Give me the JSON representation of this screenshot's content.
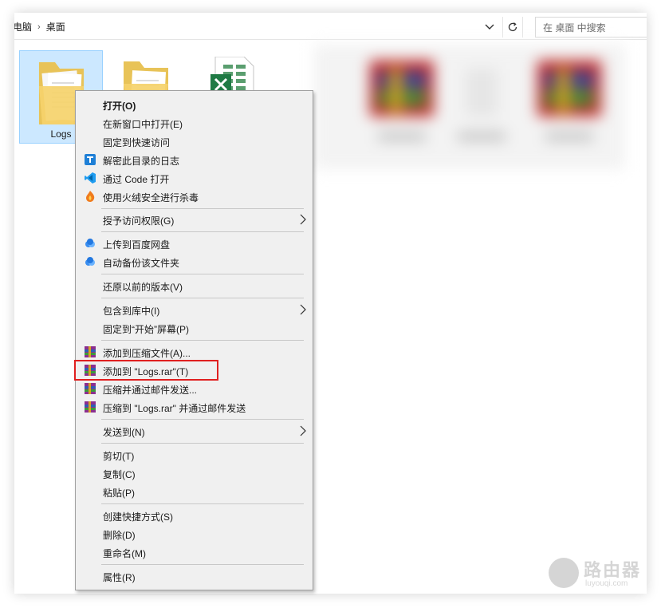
{
  "address_bar": {
    "crumbs": [
      "电脑",
      "桌面"
    ],
    "separator": "›",
    "search_placeholder": "在 桌面 中搜索"
  },
  "desktop_items": [
    {
      "label": "Logs",
      "selected": true,
      "icon": "folder-icon"
    },
    {
      "label": "",
      "selected": false,
      "icon": "folder-icon"
    },
    {
      "label": "",
      "selected": false,
      "icon": "excel-file-icon"
    }
  ],
  "context_menu": {
    "items": [
      {
        "id": "open",
        "label": "打开(O)",
        "bold": true,
        "icon": ""
      },
      {
        "id": "open-new-window",
        "label": "在新窗口中打开(E)",
        "icon": ""
      },
      {
        "id": "pin-quick-access",
        "label": "固定到快速访问",
        "icon": ""
      },
      {
        "id": "decrypt-log",
        "label": "解密此目录的日志",
        "icon": "decrypt-icon"
      },
      {
        "id": "open-with-code",
        "label": "通过 Code 打开",
        "icon": "vscode-icon"
      },
      {
        "id": "huorong-scan",
        "label": "使用火绒安全进行杀毒",
        "icon": "huorong-icon"
      },
      {
        "id": "grant-access",
        "label": "授予访问权限(G)",
        "icon": "",
        "submenu": true
      },
      {
        "id": "upload-baidu",
        "label": "上传到百度网盘",
        "icon": "baidu-netdisk-icon"
      },
      {
        "id": "auto-backup",
        "label": "自动备份该文件夹",
        "icon": "baidu-netdisk-icon"
      },
      {
        "id": "restore-version",
        "label": "还原以前的版本(V)",
        "icon": ""
      },
      {
        "id": "include-library",
        "label": "包含到库中(I)",
        "icon": "",
        "submenu": true
      },
      {
        "id": "pin-start",
        "label": "固定到“开始”屏幕(P)",
        "icon": ""
      },
      {
        "id": "add-archive",
        "label": "添加到压缩文件(A)...",
        "icon": "winrar-icon"
      },
      {
        "id": "add-logs-rar",
        "label": "添加到 \"Logs.rar\"(T)",
        "icon": "winrar-icon",
        "highlighted": true
      },
      {
        "id": "compress-email",
        "label": "压缩并通过邮件发送...",
        "icon": "winrar-icon"
      },
      {
        "id": "compress-logs-email",
        "label": "压缩到 \"Logs.rar\" 并通过邮件发送",
        "icon": "winrar-icon"
      },
      {
        "id": "send-to",
        "label": "发送到(N)",
        "icon": "",
        "submenu": true
      },
      {
        "id": "cut",
        "label": "剪切(T)",
        "icon": ""
      },
      {
        "id": "copy",
        "label": "复制(C)",
        "icon": ""
      },
      {
        "id": "paste",
        "label": "粘贴(P)",
        "icon": ""
      },
      {
        "id": "create-shortcut",
        "label": "创建快捷方式(S)",
        "icon": ""
      },
      {
        "id": "delete",
        "label": "删除(D)",
        "icon": ""
      },
      {
        "id": "rename",
        "label": "重命名(M)",
        "icon": ""
      },
      {
        "id": "properties",
        "label": "属性(R)",
        "icon": ""
      }
    ]
  },
  "watermark": {
    "title": "路由器",
    "subtitle": "luyouqi.com"
  },
  "colors": {
    "selection_bg": "#cce8ff",
    "highlight_border": "#e02020",
    "menu_bg": "#f0f0f0"
  }
}
